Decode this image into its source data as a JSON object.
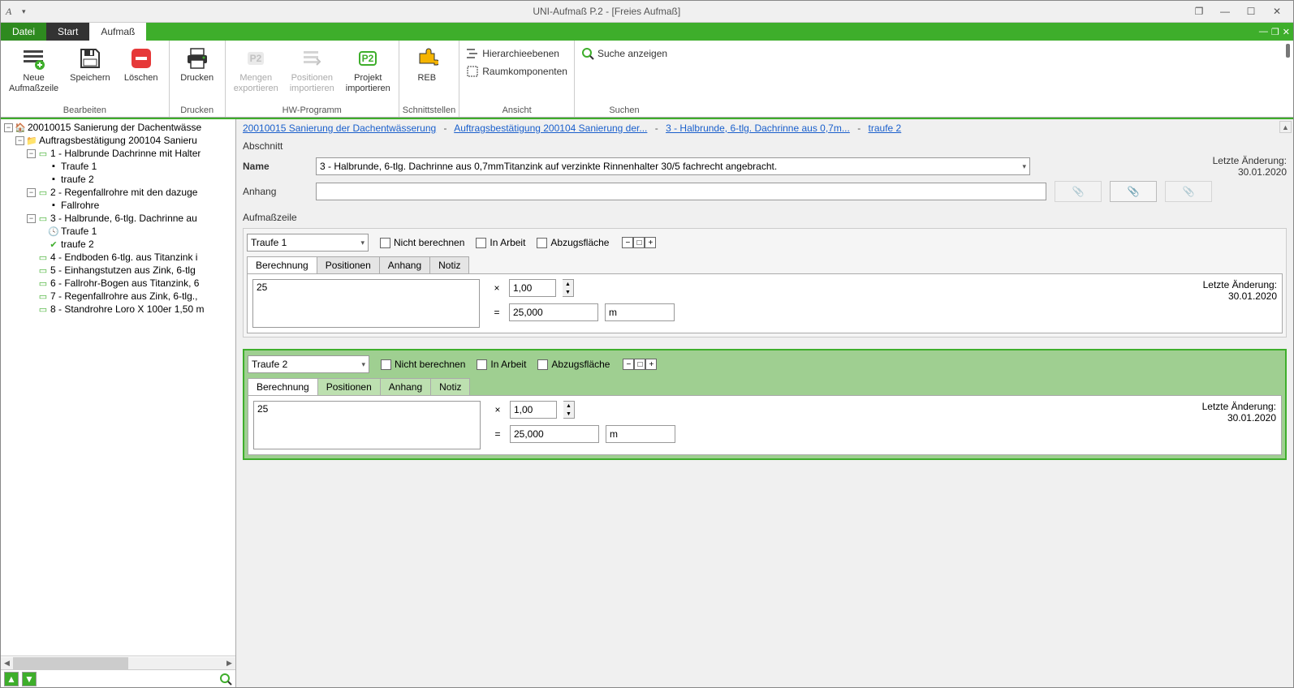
{
  "window": {
    "title": "UNI-Aufmaß P.2 - [Freies Aufmaß]"
  },
  "tabs": {
    "file": "Datei",
    "start": "Start",
    "aufmass": "Aufmaß"
  },
  "ribbon": {
    "groups": {
      "bearbeiten": "Bearbeiten",
      "drucken": "Drucken",
      "hwprogramm": "HW-Programm",
      "schnittstellen": "Schnittstellen",
      "ansicht": "Ansicht",
      "suchen": "Suchen"
    },
    "buttons": {
      "neue_zeile": "Neue\nAufmaßzeile",
      "speichern": "Speichern",
      "loeschen": "Löschen",
      "drucken": "Drucken",
      "mengen_export": "Mengen\nexportieren",
      "positionen_import": "Positionen\nimportieren",
      "projekt_import": "Projekt\nimportieren",
      "reb": "REB",
      "hierarchie": "Hierarchieebenen",
      "raumkomponenten": "Raumkomponenten",
      "suche_anzeigen": "Suche anzeigen"
    }
  },
  "tree": {
    "root": "20010015 Sanierung der Dachentwässe",
    "auftrag": "Auftragsbestätigung 200104 Sanieru",
    "items": [
      "1 - Halbrunde Dachrinne mit Halter",
      "2 - Regenfallrohre mit den dazuge",
      "3 - Halbrunde, 6-tlg. Dachrinne au",
      "4 - Endboden 6-tlg. aus Titanzink i",
      "5 - Einhangstutzen aus Zink, 6-tlg",
      "6 - Fallrohr-Bogen aus Titanzink, 6",
      "7 - Regenfallrohre aus Zink, 6-tlg.,",
      "8 - Standrohre Loro X 100er 1,50 m"
    ],
    "sub1": {
      "a": "Traufe 1",
      "b": "traufe 2"
    },
    "sub2": {
      "a": "Fallrohre"
    },
    "sub3": {
      "a": "Traufe 1",
      "b": "traufe 2"
    }
  },
  "breadcrumb": {
    "a": "20010015 Sanierung der Dachentwässerung",
    "b": "Auftragsbestätigung 200104 Sanierung der...",
    "c": "3 - Halbrunde, 6-tlg. Dachrinne aus 0,7m...",
    "d": "traufe 2",
    "sep": "-"
  },
  "abschnitt": {
    "title": "Abschnitt",
    "name_label": "Name",
    "name_value": "3 - Halbrunde, 6-tlg. Dachrinne aus 0,7mmTitanzink auf verzinkte Rinnenhalter 30/5 fachrecht angebracht.",
    "anhang_label": "Anhang",
    "last_change_label": "Letzte Änderung:",
    "last_change_date": "30.01.2020"
  },
  "aufmasszeile": {
    "title": "Aufmaßzeile",
    "nicht_berechnen": "Nicht berechnen",
    "in_arbeit": "In Arbeit",
    "abzugsflaeche": "Abzugsfläche",
    "tabs": {
      "berechnung": "Berechnung",
      "positionen": "Positionen",
      "anhang": "Anhang",
      "notiz": "Notiz"
    }
  },
  "zeile1": {
    "name": "Traufe 1",
    "calc": "25",
    "factor": "1,00",
    "result": "25,000",
    "unit": "m",
    "change_label": "Letzte Änderung:",
    "change_date": "30.01.2020"
  },
  "zeile2": {
    "name": "Traufe 2",
    "calc": "25",
    "factor": "1,00",
    "result": "25,000",
    "unit": "m",
    "change_label": "Letzte Änderung:",
    "change_date": "30.01.2020"
  }
}
